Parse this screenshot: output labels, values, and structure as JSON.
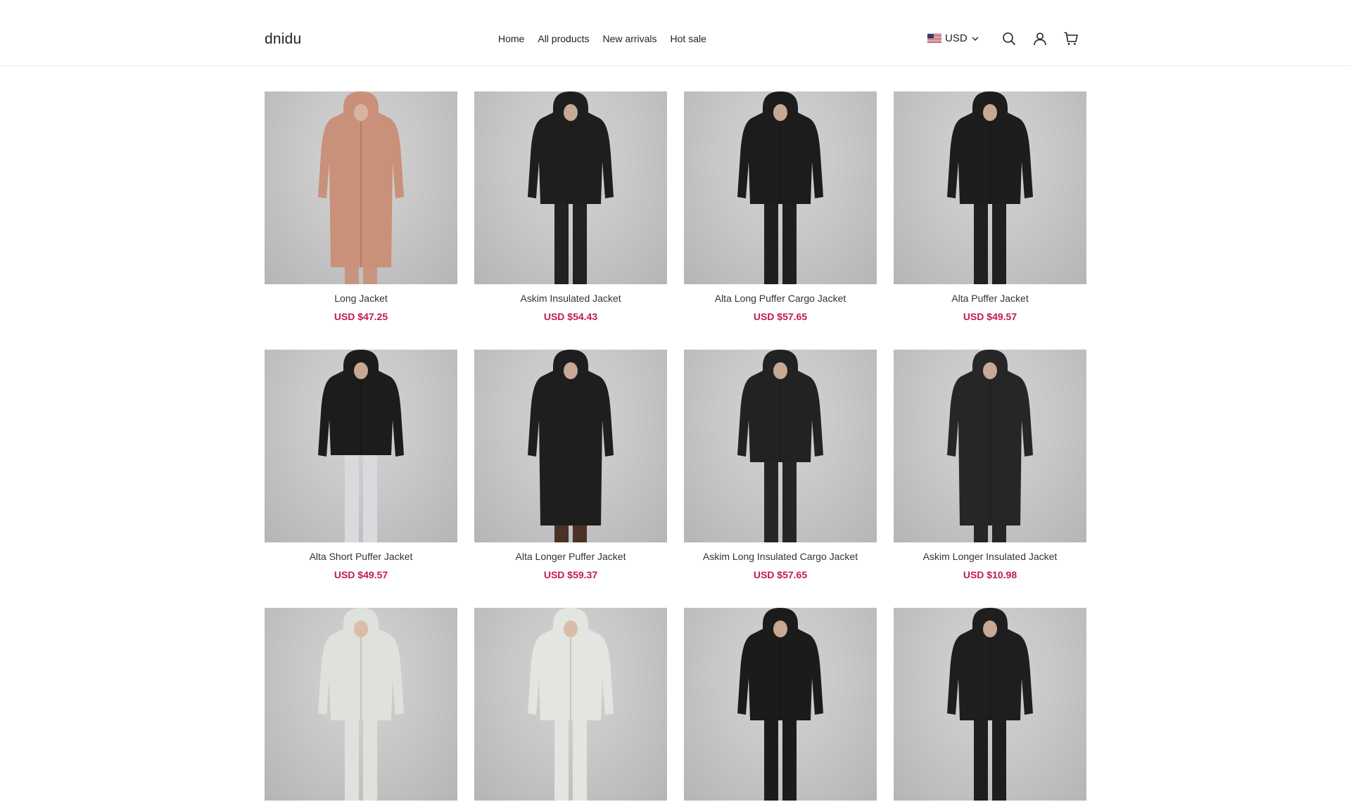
{
  "brand": {
    "name": "dnidu"
  },
  "nav": {
    "items": [
      {
        "label": "Home"
      },
      {
        "label": "All products"
      },
      {
        "label": "New arrivals"
      },
      {
        "label": "Hot sale"
      }
    ]
  },
  "currency": {
    "code": "USD",
    "flag_icon": "us-flag-icon"
  },
  "header_icons": [
    "search-icon",
    "account-icon",
    "cart-icon"
  ],
  "colors": {
    "price": "#c2185b",
    "text": "#222222",
    "image_bg": "#c8c8c8"
  },
  "products": [
    {
      "name": "Long Jacket",
      "price": "USD $47.25",
      "garment": "#c9907a",
      "pants": "#c7957f"
    },
    {
      "name": "Askim Insulated Jacket",
      "price": "USD $54.43",
      "garment": "#1e1e1e",
      "pants": "#222222"
    },
    {
      "name": "Alta Long Puffer Cargo Jacket",
      "price": "USD $57.65",
      "garment": "#1c1c1c",
      "pants": "#1f1f1f"
    },
    {
      "name": "Alta Puffer Jacket",
      "price": "USD $49.57",
      "garment": "#1d1d1d",
      "pants": "#202020"
    },
    {
      "name": "Alta Short Puffer Jacket",
      "price": "USD $49.57",
      "garment": "#1c1c1c",
      "pants": "#d9dadd"
    },
    {
      "name": "Alta Longer Puffer Jacket",
      "price": "USD $59.37",
      "garment": "#1e1e1e",
      "pants": "#4a3226"
    },
    {
      "name": "Askim Long Insulated Cargo Jacket",
      "price": "USD $57.65",
      "garment": "#222222",
      "pants": "#252525"
    },
    {
      "name": "Askim Longer Insulated Jacket",
      "price": "USD $10.98",
      "garment": "#262626",
      "pants": "#262626"
    },
    {
      "name": "",
      "price": "",
      "garment": "#dfe2dc",
      "pants": "#dfe2dc"
    },
    {
      "name": "",
      "price": "",
      "garment": "#e2e5e0",
      "pants": "#e2e5e0"
    },
    {
      "name": "",
      "price": "",
      "garment": "#1b1b1b",
      "pants": "#1b1b1b"
    },
    {
      "name": "",
      "price": "",
      "garment": "#1e1e1e",
      "pants": "#1e1e1e"
    }
  ]
}
